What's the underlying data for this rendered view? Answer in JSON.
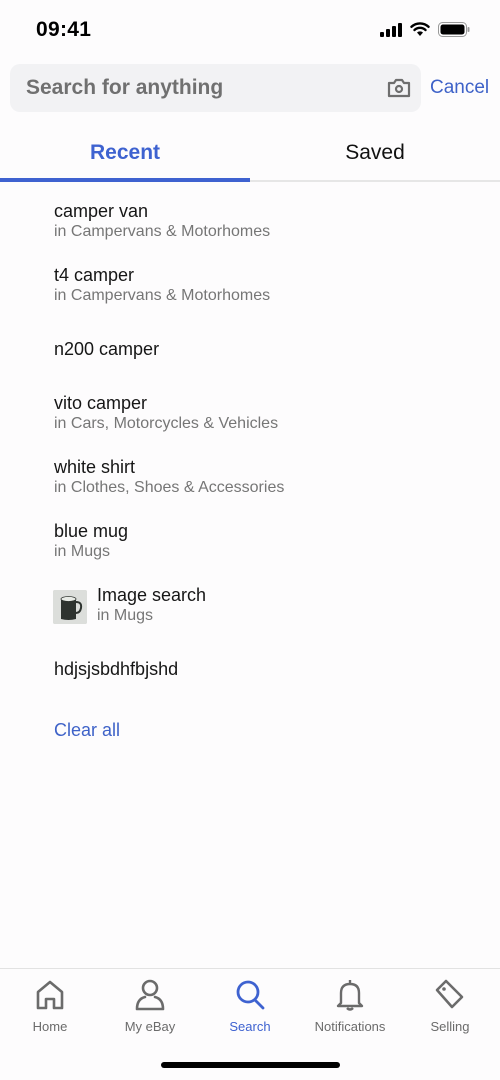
{
  "status_bar": {
    "time": "09:41"
  },
  "search": {
    "placeholder": "Search for anything",
    "value": "",
    "cancel_label": "Cancel",
    "camera_icon": "camera-icon"
  },
  "tabs": [
    {
      "label": "Recent",
      "active": true
    },
    {
      "label": "Saved",
      "active": false
    }
  ],
  "recent_searches": [
    {
      "title": "camper van",
      "category": "in Campervans & Motorhomes"
    },
    {
      "title": "t4 camper",
      "category": "in Campervans & Motorhomes"
    },
    {
      "title": "n200 camper",
      "category": ""
    },
    {
      "title": "vito camper",
      "category": "in Cars, Motorcycles & Vehicles"
    },
    {
      "title": "white shirt",
      "category": "in Clothes, Shoes & Accessories"
    },
    {
      "title": "blue mug",
      "category": "in Mugs"
    },
    {
      "title": "Image search",
      "category": "in Mugs",
      "thumbnail": "mug-image"
    },
    {
      "title": "hdjsjsbdhfbjshd",
      "category": ""
    }
  ],
  "clear_all_label": "Clear all",
  "bottom_nav": [
    {
      "label": "Home",
      "icon": "home-icon",
      "active": false
    },
    {
      "label": "My eBay",
      "icon": "user-icon",
      "active": false
    },
    {
      "label": "Search",
      "icon": "search-icon",
      "active": true
    },
    {
      "label": "Notifications",
      "icon": "bell-icon",
      "active": false
    },
    {
      "label": "Selling",
      "icon": "tag-icon",
      "active": false
    }
  ],
  "colors": {
    "accent": "#3e62d0",
    "text": "#161616",
    "secondary": "#767676"
  }
}
